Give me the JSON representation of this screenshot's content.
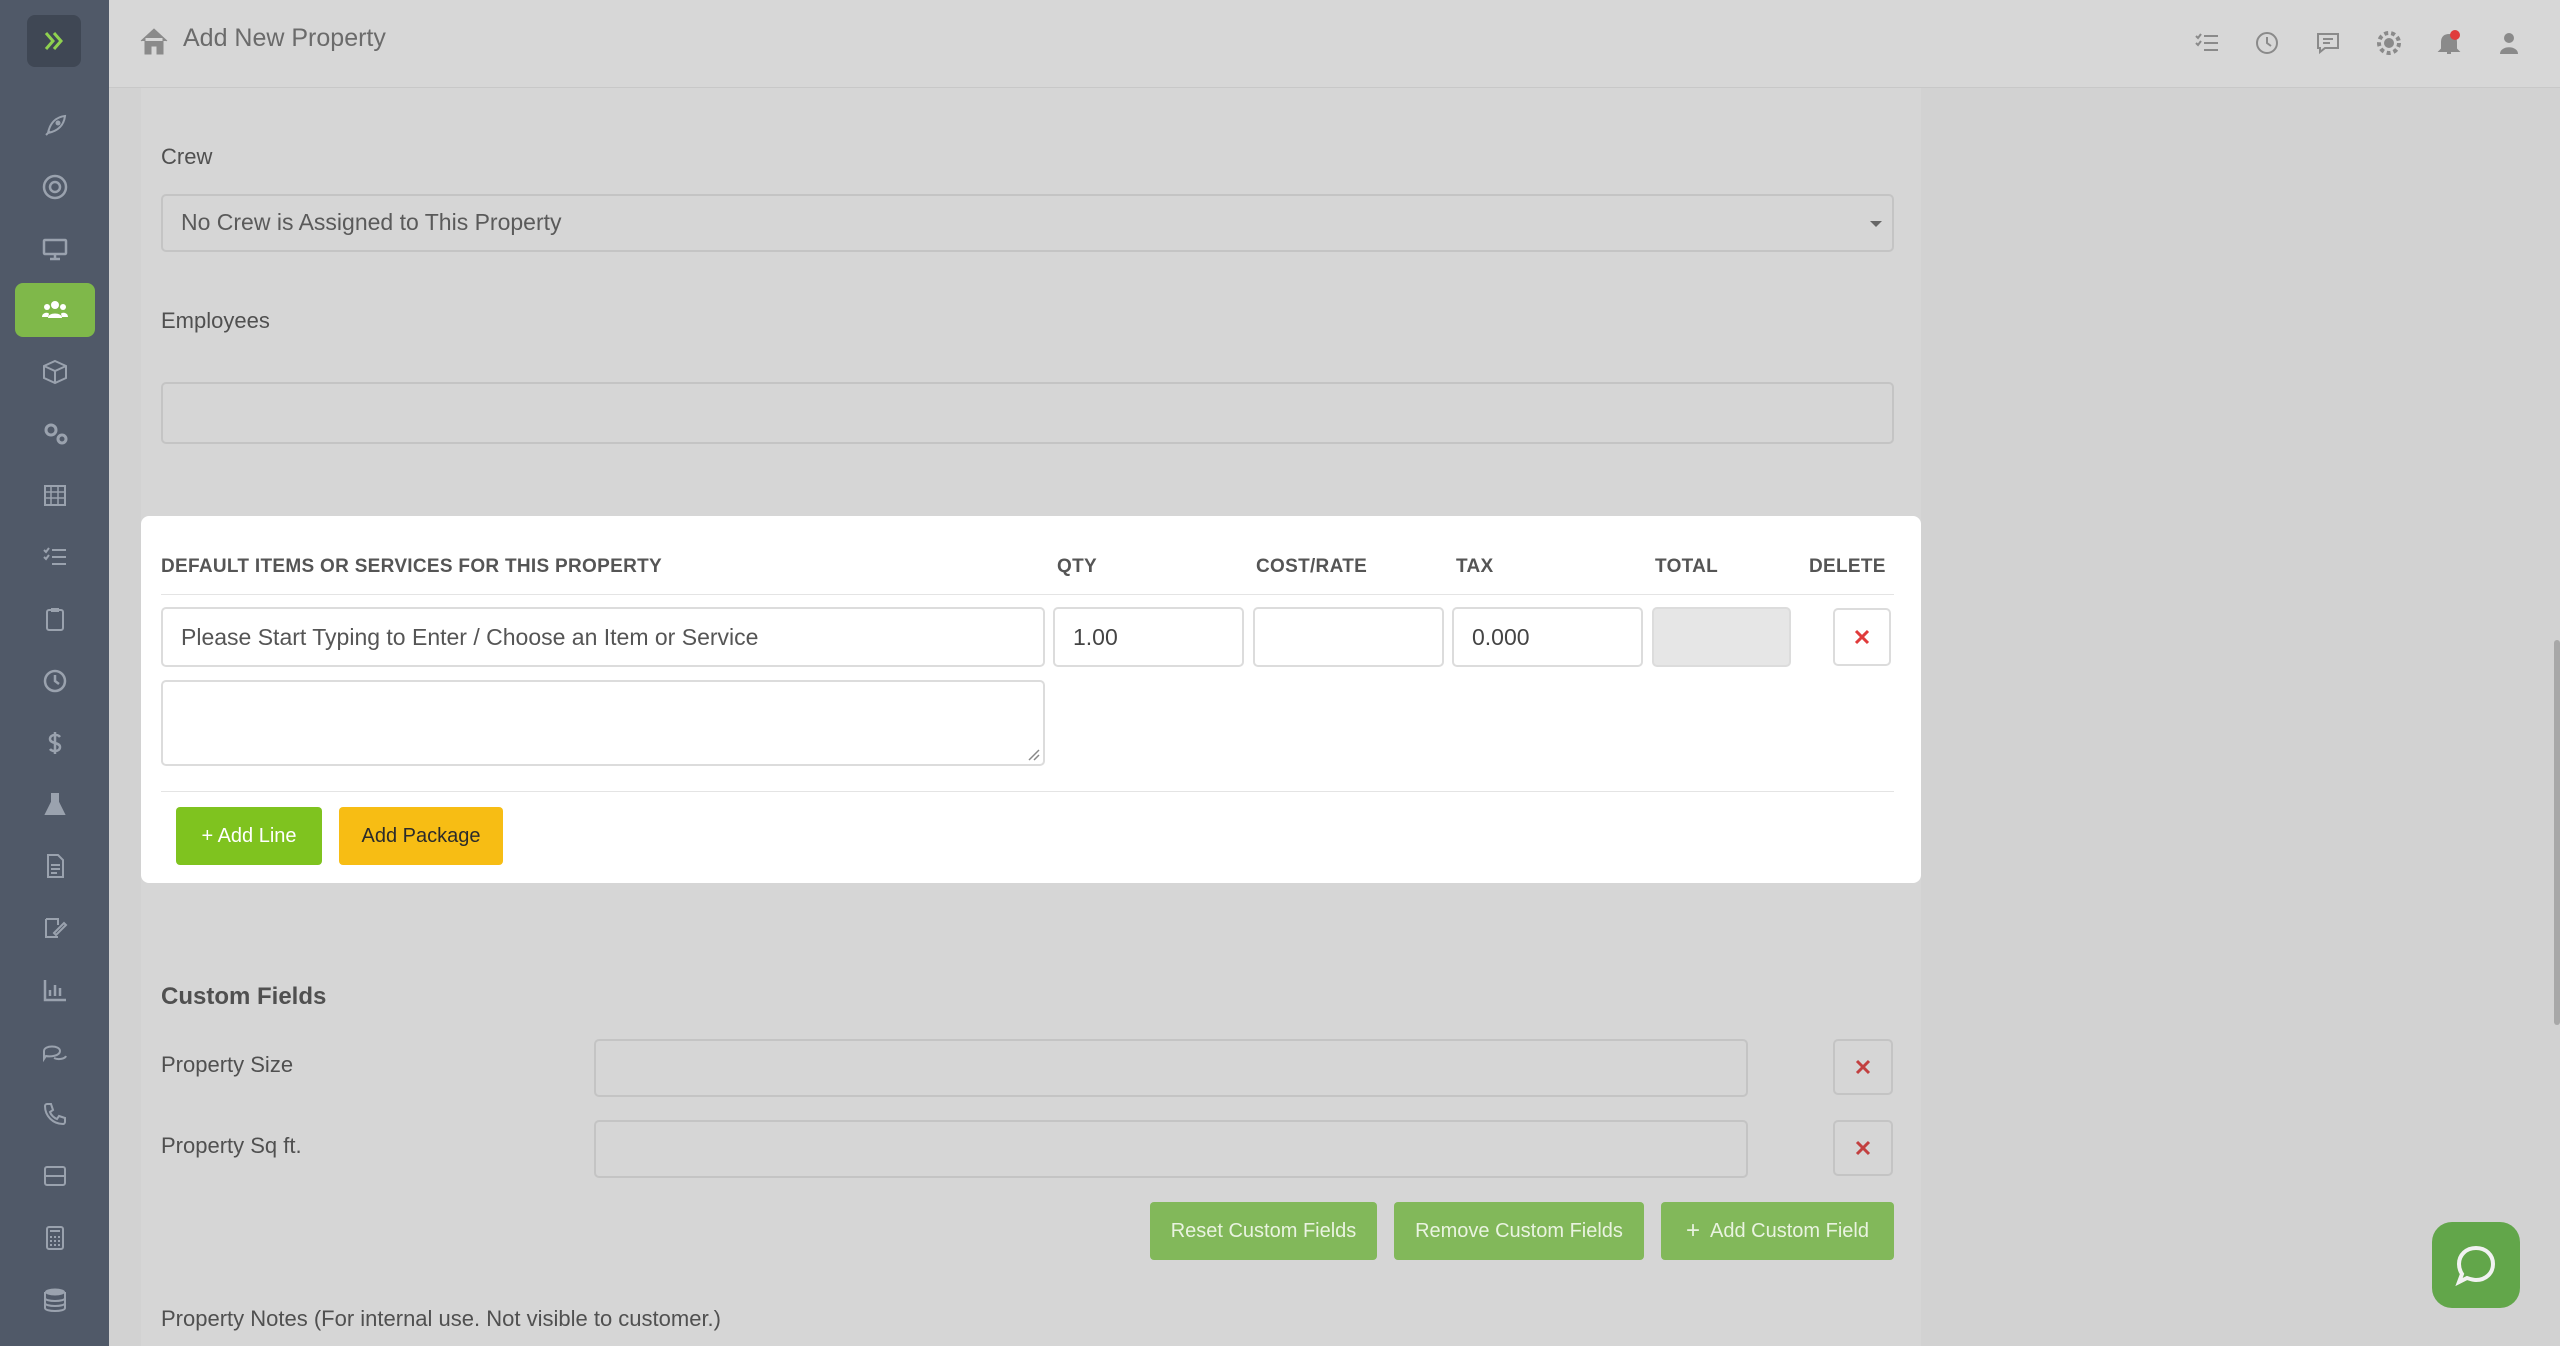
{
  "header": {
    "title": "Add New Property"
  },
  "form": {
    "crew_label": "Crew",
    "crew_value": "No Crew is Assigned to This Property",
    "employees_label": "Employees"
  },
  "items_table": {
    "headers": {
      "item": "DEFAULT ITEMS OR SERVICES FOR THIS PROPERTY",
      "qty": "QTY",
      "cost": "COST/RATE",
      "tax": "TAX",
      "total": "TOTAL",
      "delete": "DELETE"
    },
    "row": {
      "item_placeholder": "Please Start Typing to Enter / Choose an Item or Service",
      "qty": "1.00",
      "cost": "",
      "tax": "0.000",
      "total": ""
    },
    "add_line_label": "+ Add Line",
    "add_package_label": "Add Package"
  },
  "custom_fields": {
    "title": "Custom Fields",
    "fields": [
      {
        "label": "Property Size",
        "value": ""
      },
      {
        "label": "Property Sq ft.",
        "value": ""
      }
    ],
    "reset_label": "Reset Custom Fields",
    "remove_label": "Remove Custom Fields",
    "add_label": "Add Custom Field"
  },
  "notes": {
    "label": "Property Notes (For internal use. Not visible to customer.)"
  },
  "sidebar": {
    "items": [
      {
        "icon": "rocket-icon"
      },
      {
        "icon": "lifebuoy-icon"
      },
      {
        "icon": "monitor-icon"
      },
      {
        "icon": "users-icon",
        "active": true
      },
      {
        "icon": "box-icon"
      },
      {
        "icon": "gears-icon"
      },
      {
        "icon": "calendar-grid-icon"
      },
      {
        "icon": "list-check-icon"
      },
      {
        "icon": "clipboard-icon"
      },
      {
        "icon": "clock-icon"
      },
      {
        "icon": "dollar-icon"
      },
      {
        "icon": "flask-icon"
      },
      {
        "icon": "document-icon"
      },
      {
        "icon": "signature-icon"
      },
      {
        "icon": "bar-chart-icon"
      },
      {
        "icon": "chat-bubbles-icon"
      },
      {
        "icon": "phone-icon"
      },
      {
        "icon": "inbox-stack-icon"
      },
      {
        "icon": "calculator-icon"
      },
      {
        "icon": "database-icon"
      }
    ]
  },
  "colors": {
    "accent_green": "#7fc31f",
    "accent_yellow": "#f7bd14",
    "sidebar_bg": "#505968",
    "danger_red": "#e03b3b"
  }
}
